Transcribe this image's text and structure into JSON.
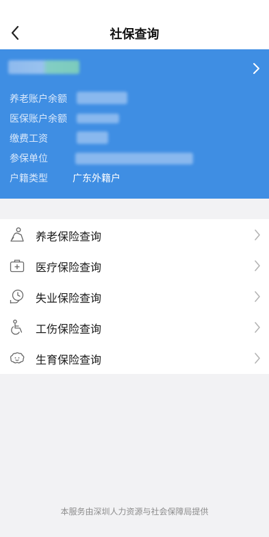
{
  "header": {
    "title": "社保查询",
    "back_icon": "chevron-left-icon"
  },
  "account_card": {
    "background": "#3f8ee3",
    "rows": [
      {
        "label": "养老账户余额",
        "value": ""
      },
      {
        "label": "医保账户余额",
        "value": ""
      },
      {
        "label": "缴费工资",
        "value": ""
      },
      {
        "label": "参保单位",
        "value": ""
      },
      {
        "label": "户籍类型",
        "value": "广东外籍户"
      }
    ]
  },
  "menu": {
    "items": [
      {
        "label": "养老保险查询",
        "icon": "elderly-person-icon"
      },
      {
        "label": "医疗保险查询",
        "icon": "medical-kit-icon"
      },
      {
        "label": "失业保险查询",
        "icon": "clock-hand-icon"
      },
      {
        "label": "工伤保险查询",
        "icon": "wheelchair-icon"
      },
      {
        "label": "生育保险查询",
        "icon": "baby-icon"
      }
    ]
  },
  "footer": {
    "text": "本服务由深圳人力资源与社会保障局提供"
  }
}
